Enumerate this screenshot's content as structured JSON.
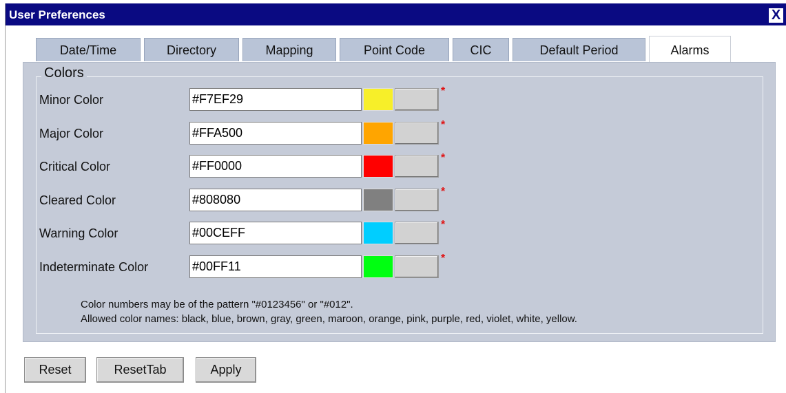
{
  "window": {
    "title": "User Preferences",
    "close_label": "X"
  },
  "tabs": [
    {
      "label": "Date/Time"
    },
    {
      "label": "Directory"
    },
    {
      "label": "Mapping"
    },
    {
      "label": "Point Code"
    },
    {
      "label": "CIC"
    },
    {
      "label": "Default Period"
    },
    {
      "label": "Alarms",
      "active": true
    }
  ],
  "colors_section": {
    "legend": "Colors",
    "rows": [
      {
        "label": "Minor Color",
        "value": "#F7EF29",
        "swatch": "#F7EF29",
        "required": "*"
      },
      {
        "label": "Major Color",
        "value": "#FFA500",
        "swatch": "#FFA500",
        "required": "*"
      },
      {
        "label": "Critical Color",
        "value": "#FF0000",
        "swatch": "#FF0000",
        "required": "*"
      },
      {
        "label": "Cleared Color",
        "value": "#808080",
        "swatch": "#808080",
        "required": "*"
      },
      {
        "label": "Warning Color",
        "value": "#00CEFF",
        "swatch": "#00CEFF",
        "required": "*"
      },
      {
        "label": "Indeterminate Color",
        "value": "#00FF11",
        "swatch": "#00FF11",
        "required": "*"
      }
    ],
    "note_line1": "Color numbers may be of the pattern \"#0123456\" or \"#012\".",
    "note_line2": "Allowed color names: black, blue, brown, gray, green, maroon, orange, pink, purple, red, violet, white, yellow."
  },
  "buttons": {
    "reset": "Reset",
    "reset_tab": "ResetTab",
    "apply": "Apply"
  }
}
